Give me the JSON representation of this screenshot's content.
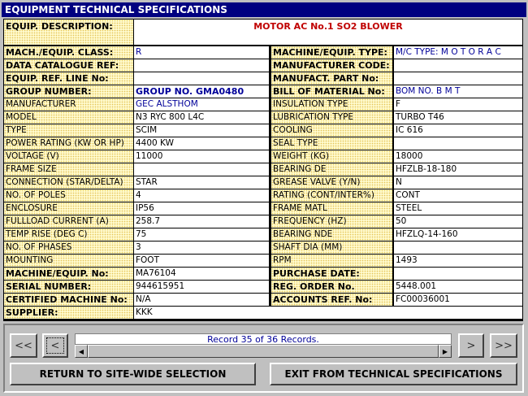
{
  "window": {
    "title": "EQUIPMENT TECHNICAL SPECIFICATIONS"
  },
  "description": {
    "label": "EQUIP. DESCRIPTION:",
    "value": "MOTOR AC No.1 SO2 BLOWER"
  },
  "rows": [
    {
      "l1": "MACH./EQUIP. CLASS:",
      "v1": "R",
      "l2": "MACHINE/EQUIP. TYPE:",
      "v2": "M/C TYPE: M O T O R A C"
    },
    {
      "l1": "DATA CATALOGUE REF:",
      "v1": "",
      "l2": "MANUFACTURER CODE:",
      "v2": ""
    },
    {
      "l1": "EQUIP. REF. LINE No:",
      "v1": "",
      "l2": "MANUFACT. PART No:",
      "v2": ""
    },
    {
      "l1": "GROUP NUMBER:",
      "v1": "GROUP NO. GMA0480",
      "l2": "BILL OF MATERIAL No:",
      "v2": "BOM NO.  B M T"
    },
    {
      "l1": "MANUFACTURER",
      "v1": "GEC ALSTHOM",
      "l2": "INSULATION TYPE",
      "v2": "F"
    },
    {
      "l1": "MODEL",
      "v1": "N3 RYC 800 L4C",
      "l2": "LUBRICATION TYPE",
      "v2": "TURBO T46"
    },
    {
      "l1": "TYPE",
      "v1": "SCIM",
      "l2": "COOLING",
      "v2": "IC 616"
    },
    {
      "l1": "POWER RATING (KW OR HP)",
      "v1": "4400 KW",
      "l2": "SEAL TYPE",
      "v2": ""
    },
    {
      "l1": "VOLTAGE (V)",
      "v1": "11000",
      "l2": "WEIGHT (KG)",
      "v2": "18000"
    },
    {
      "l1": "FRAME SIZE",
      "v1": "",
      "l2": "BEARING  DE",
      "v2": "HFZLB-18-180"
    },
    {
      "l1": "CONNECTION (STAR/DELTA)",
      "v1": "STAR",
      "l2": "GREASE VALVE (Y/N)",
      "v2": "N"
    },
    {
      "l1": "NO. OF POLES",
      "v1": "4",
      "l2": "RATING (CONT/INTER%)",
      "v2": "CONT"
    },
    {
      "l1": "ENCLOSURE",
      "v1": "IP56",
      "l2": "FRAME MATL",
      "v2": "STEEL"
    },
    {
      "l1": "FULLLOAD CURRENT (A)",
      "v1": "258.7",
      "l2": "FREQUENCY (HZ)",
      "v2": "50"
    },
    {
      "l1": "TEMP RISE (DEG C)",
      "v1": "75",
      "l2": "BEARING  NDE",
      "v2": "HFZLQ-14-160"
    },
    {
      "l1": "NO. OF PHASES",
      "v1": "3",
      "l2": "SHAFT DIA (MM)",
      "v2": ""
    },
    {
      "l1": "MOUNTING",
      "v1": "FOOT",
      "l2": "RPM",
      "v2": "1493"
    },
    {
      "l1": "MACHINE/EQUIP. No:",
      "v1": "MA76104",
      "l2": "PURCHASE DATE:",
      "v2": ""
    },
    {
      "l1": "SERIAL NUMBER:",
      "v1": "944615951",
      "l2": "REG. ORDER No.",
      "v2": "5448.001"
    },
    {
      "l1": "CERTIFIED MACHINE No:",
      "v1": "N/A",
      "l2": "ACCOUNTS REF. No:",
      "v2": "FC00036001"
    }
  ],
  "supplier": {
    "label": "SUPPLIER:",
    "value": "KKK"
  },
  "nav": {
    "first": "<<",
    "prev": "<",
    "next": ">",
    "last": ">>",
    "record_text": "Record 35 of 36 Records.",
    "scroll_left_icon": "triangle-left-icon",
    "scroll_right_icon": "triangle-right-icon"
  },
  "buttons": {
    "return_label": "RETURN TO SITE-WIDE SELECTION",
    "exit_label": "EXIT FROM TECHNICAL SPECIFICATIONS"
  }
}
